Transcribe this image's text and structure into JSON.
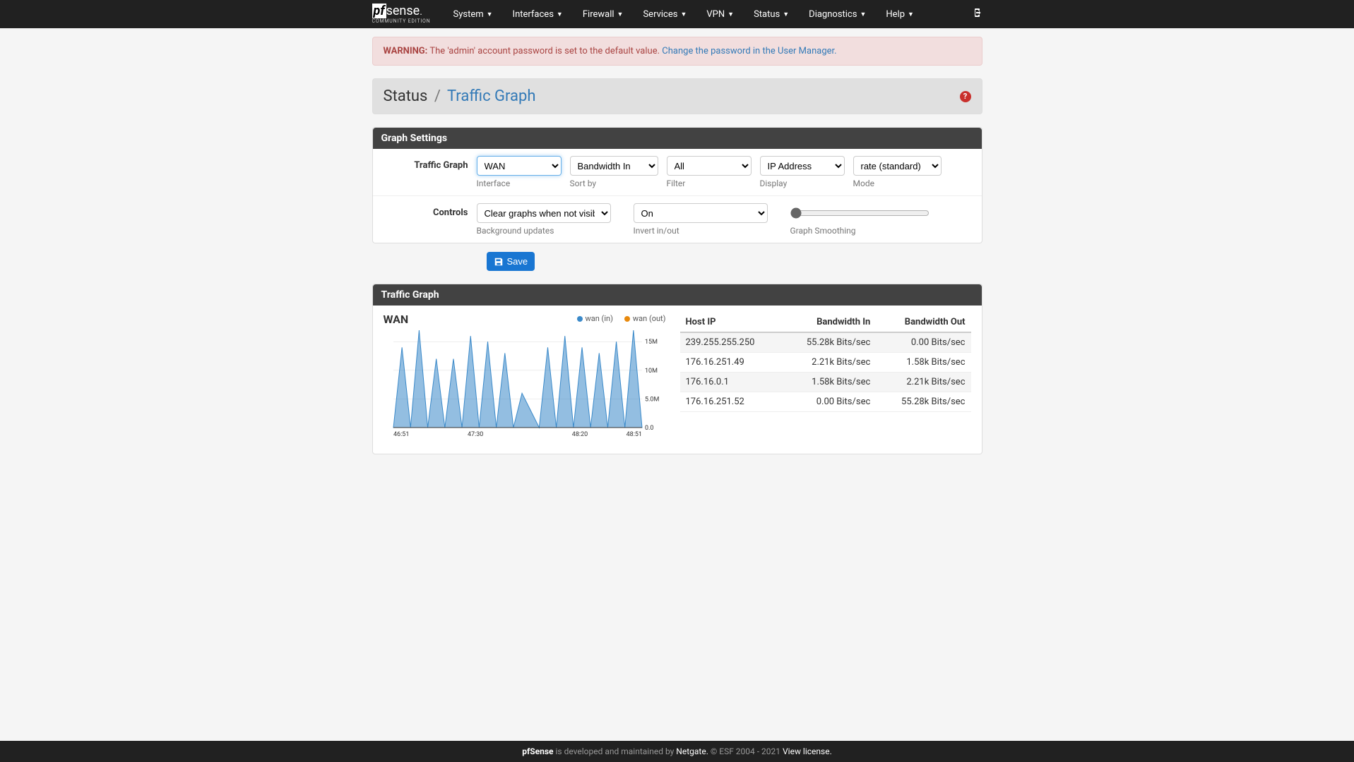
{
  "nav": {
    "brand_main": "sense",
    "brand_prefix": "pf",
    "brand_sub": "COMMUNITY EDITION",
    "items": [
      "System",
      "Interfaces",
      "Firewall",
      "Services",
      "VPN",
      "Status",
      "Diagnostics",
      "Help"
    ]
  },
  "alert": {
    "prefix": "WARNING:",
    "text": " The 'admin' account password is set to the default value. ",
    "link": "Change the password in the User Manager."
  },
  "breadcrumb": {
    "root": "Status",
    "sep": "/",
    "page": "Traffic Graph"
  },
  "panels": {
    "settings_title": "Graph Settings",
    "graph_title": "Traffic Graph"
  },
  "form": {
    "row1_label": "Traffic Graph",
    "interface": {
      "value": "WAN",
      "help": "Interface"
    },
    "sort": {
      "value": "Bandwidth In",
      "help": "Sort by"
    },
    "filter": {
      "value": "All",
      "help": "Filter"
    },
    "display": {
      "value": "IP Address",
      "help": "Display"
    },
    "mode": {
      "value": "rate (standard)",
      "help": "Mode"
    },
    "row2_label": "Controls",
    "bg": {
      "value": "Clear graphs when not visible.",
      "help": "Background updates"
    },
    "invert": {
      "value": "On",
      "help": "Invert in/out"
    },
    "smooth": {
      "help": "Graph Smoothing"
    },
    "save_label": "Save"
  },
  "chart": {
    "title": "WAN",
    "legend_in": "wan (in)",
    "legend_out": "wan (out)",
    "color_in": "#3a89c9",
    "color_out": "#e8890c"
  },
  "chart_data": {
    "type": "area",
    "xlabel": "",
    "ylabel": "",
    "x_ticks": [
      "46:51",
      "47:30",
      "48:20",
      "48:51"
    ],
    "y_ticks": [
      "0.0",
      "5.0M",
      "10M",
      "15M"
    ],
    "ylim": [
      0,
      17000000
    ],
    "series": [
      {
        "name": "wan (in)",
        "color": "#3a89c9",
        "values": [
          0,
          14000000,
          0,
          17000000,
          0,
          12000000,
          0,
          12000000,
          0,
          16000000,
          0,
          15000000,
          0,
          13000000,
          0,
          6000000,
          3000000,
          0,
          14000000,
          0,
          16000000,
          0,
          14000000,
          0,
          13000000,
          0,
          15000000,
          0,
          17000000,
          0
        ]
      },
      {
        "name": "wan (out)",
        "color": "#e8890c",
        "values": [
          0,
          0,
          0,
          0,
          0,
          0,
          0,
          0,
          0,
          0,
          0,
          0,
          0,
          0,
          0,
          0,
          0,
          0,
          0,
          0,
          0,
          0,
          0,
          0,
          0,
          0,
          0,
          0,
          0,
          0
        ]
      }
    ]
  },
  "table": {
    "headers": [
      "Host IP",
      "Bandwidth In",
      "Bandwidth Out"
    ],
    "rows": [
      {
        "ip": "239.255.255.250",
        "in": "55.28k Bits/sec",
        "out": "0.00 Bits/sec"
      },
      {
        "ip": "176.16.251.49",
        "in": "2.21k Bits/sec",
        "out": "1.58k Bits/sec"
      },
      {
        "ip": "176.16.0.1",
        "in": "1.58k Bits/sec",
        "out": "2.21k Bits/sec"
      },
      {
        "ip": "176.16.251.52",
        "in": "0.00 Bits/sec",
        "out": "55.28k Bits/sec"
      }
    ]
  },
  "footer": {
    "brand": "pfSense",
    "mid": " is developed and maintained by ",
    "netgate": "Netgate.",
    "copy": " © ESF 2004 - 2021 ",
    "license": "View license."
  }
}
